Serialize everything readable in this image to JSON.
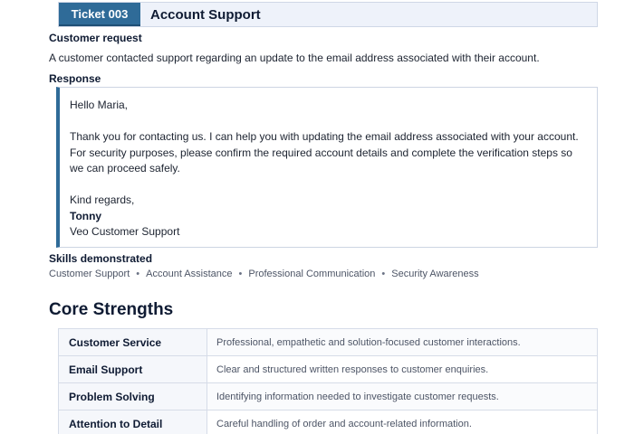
{
  "ticket": {
    "badge": "Ticket 003",
    "title": "Account Support"
  },
  "request": {
    "label": "Customer request",
    "text": "A customer contacted support regarding an update to the email address associated with their account."
  },
  "response": {
    "label": "Response",
    "greeting": "Hello Maria,",
    "body": "Thank you for contacting us. I can help you with updating the email address associated with your account. For security purposes, please confirm the required account details and complete the verification steps so we can proceed safely.",
    "closing": "Kind regards,",
    "signature_name": "Tonny",
    "signature_team": "Veo Customer Support"
  },
  "skills": {
    "label": "Skills demonstrated",
    "separator": "•",
    "items": [
      "Customer Support",
      "Account Assistance",
      "Professional Communication",
      "Security Awareness"
    ]
  },
  "core_strengths": {
    "heading": "Core Strengths",
    "rows": [
      {
        "name": "Customer Service",
        "description": "Professional, empathetic and solution-focused customer interactions."
      },
      {
        "name": "Email Support",
        "description": "Clear and structured written responses to customer enquiries."
      },
      {
        "name": "Problem Solving",
        "description": "Identifying information needed to investigate customer requests."
      },
      {
        "name": "Attention to Detail",
        "description": "Careful handling of order and account-related information."
      }
    ]
  },
  "colors": {
    "accent": "#2f6b98",
    "heading": "#0f1b33"
  }
}
